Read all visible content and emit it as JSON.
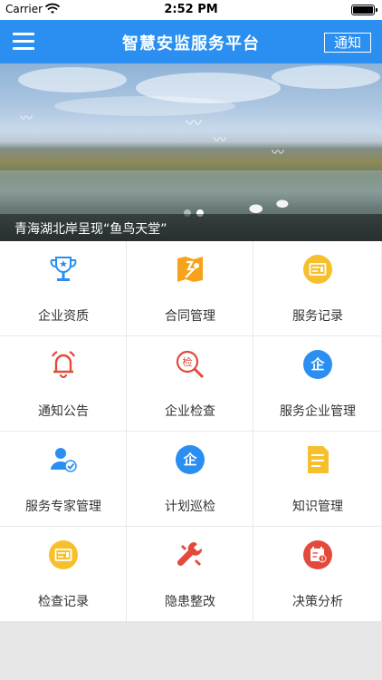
{
  "status_bar": {
    "carrier": "Carrier",
    "time": "2:52 PM",
    "battery_level": 1.0
  },
  "nav": {
    "title": "智慧安监服务平台",
    "notice_label": "通知",
    "menu_icon": "hamburger-icon"
  },
  "banner": {
    "caption": "青海湖北岸呈现“鱼鸟天堂”",
    "slide_count": 2,
    "active_slide": 1
  },
  "colors": {
    "primary": "#2a8ff0",
    "icon_blue": "#2a8ff0",
    "icon_orange": "#f7a21b",
    "icon_red": "#e24a3b",
    "icon_yellow": "#f6c02d"
  },
  "grid": {
    "items": [
      {
        "label": "企业资质",
        "icon": "trophy-icon"
      },
      {
        "label": "合同管理",
        "icon": "map-pin-icon"
      },
      {
        "label": "服务记录",
        "icon": "record-icon"
      },
      {
        "label": "通知公告",
        "icon": "bell-icon"
      },
      {
        "label": "企业检查",
        "icon": "inspect-icon"
      },
      {
        "label": "服务企业管理",
        "icon": "enterprise-icon"
      },
      {
        "label": "服务专家管理",
        "icon": "expert-icon"
      },
      {
        "label": "计划巡检",
        "icon": "enterprise-icon"
      },
      {
        "label": "知识管理",
        "icon": "document-icon"
      },
      {
        "label": "检查记录",
        "icon": "record-icon"
      },
      {
        "label": "隐患整改",
        "icon": "wrench-icon"
      },
      {
        "label": "决策分析",
        "icon": "calendar-alert-icon"
      }
    ]
  }
}
